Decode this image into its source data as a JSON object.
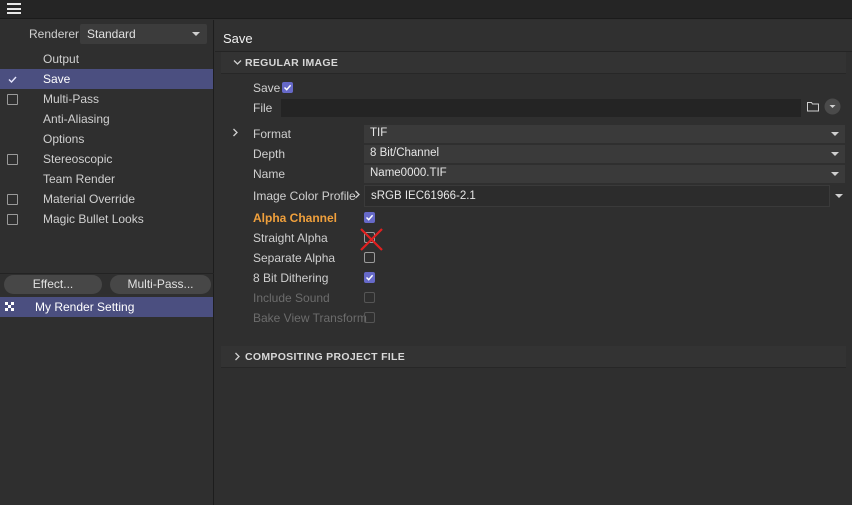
{
  "renderer": {
    "label": "Renderer",
    "value": "Standard"
  },
  "render_items": [
    {
      "label": "Output",
      "has_checkbox": false,
      "checked": false,
      "selected": false
    },
    {
      "label": "Save",
      "has_checkbox": true,
      "checked": true,
      "selected": true
    },
    {
      "label": "Multi-Pass",
      "has_checkbox": true,
      "checked": false,
      "selected": false
    },
    {
      "label": "Anti-Aliasing",
      "has_checkbox": false,
      "checked": false,
      "selected": false
    },
    {
      "label": "Options",
      "has_checkbox": false,
      "checked": false,
      "selected": false
    },
    {
      "label": "Stereoscopic",
      "has_checkbox": true,
      "checked": false,
      "selected": false
    },
    {
      "label": "Team Render",
      "has_checkbox": false,
      "checked": false,
      "selected": false
    },
    {
      "label": "Material Override",
      "has_checkbox": true,
      "checked": false,
      "selected": false
    },
    {
      "label": "Magic Bullet Looks",
      "has_checkbox": true,
      "checked": false,
      "selected": false
    }
  ],
  "buttons": {
    "effect": "Effect...",
    "multipass": "Multi-Pass..."
  },
  "render_setting": "My Render Setting",
  "panel_title": "Save",
  "section_regular": "REGULAR IMAGE",
  "section_compositing": "COMPOSITING PROJECT FILE",
  "params": {
    "save_label": "Save",
    "file_label": "File",
    "file_value": "",
    "format_label": "Format",
    "format_value": "TIF",
    "depth_label": "Depth",
    "depth_value": "8 Bit/Channel",
    "name_label": "Name",
    "name_value": "Name0000.TIF",
    "profile_label": "Image Color Profile",
    "profile_value": "sRGB IEC61966-2.1",
    "alpha_label": "Alpha Channel",
    "straight_label": "Straight Alpha",
    "separate_label": "Separate Alpha",
    "dither_label": "8 Bit Dithering",
    "sound_label": "Include Sound",
    "bake_label": "Bake View Transform"
  },
  "states": {
    "save": true,
    "alpha": true,
    "straight": false,
    "separate": false,
    "dither": true,
    "sound": false,
    "bake": false
  },
  "colors": {
    "accent": "#6669c8",
    "selection": "#4b4f80",
    "orange": "#f0a03c",
    "marker": "#e02020"
  },
  "icons": [
    "menu-icon",
    "check-icon",
    "folder-icon",
    "dropdown-circle-icon",
    "chevron-right-icon",
    "chevron-down-icon",
    "render-setting-icon",
    "cross-marker-icon"
  ]
}
